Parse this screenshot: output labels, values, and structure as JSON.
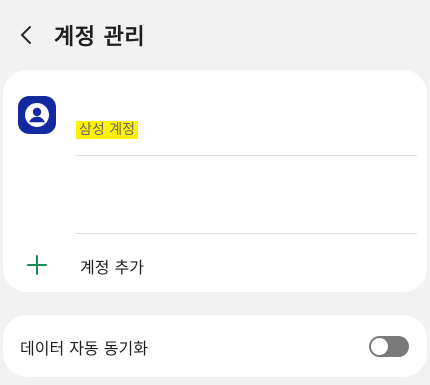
{
  "header": {
    "back_icon": "chevron-left-icon",
    "title": "계정 관리"
  },
  "accounts": {
    "account_icon": "samsung-account-icon",
    "account_label": "삼성 계정",
    "account_label_highlight": "#fff200",
    "add_icon": "plus-icon",
    "add_label": "계정 추가",
    "accent_color": "#1b8a5a"
  },
  "sync": {
    "label": "데이터 자동 동기화",
    "toggle_on": false
  }
}
